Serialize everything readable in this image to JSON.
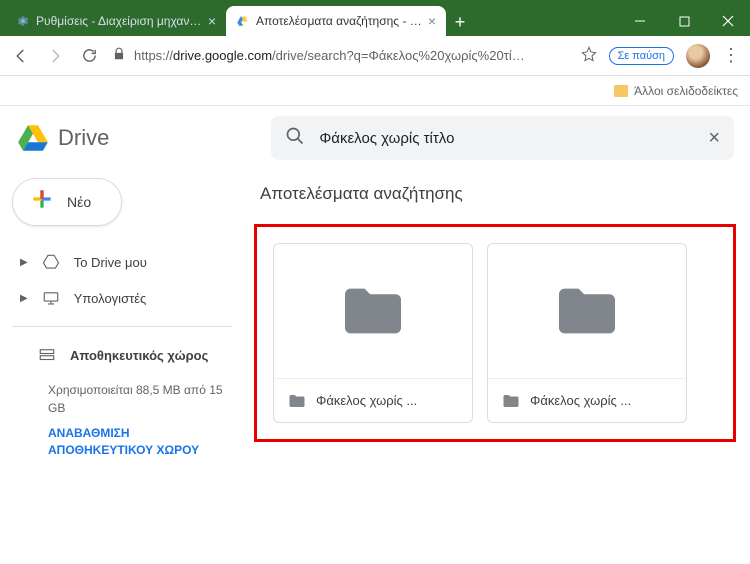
{
  "browser": {
    "tabs": [
      {
        "title": "Ρυθμίσεις - Διαχείριση μηχανών",
        "active": false
      },
      {
        "title": "Αποτελέσματα αναζήτησης - Go",
        "active": true
      }
    ],
    "url_prefix": "https://",
    "url_host": "drive.google.com",
    "url_path": "/drive/search?q=Φάκελος%20χωρίς%20τί…",
    "pause_label": "Σε παύση",
    "bookmarks_other": "Άλλοι σελιδοδείκτες"
  },
  "drive": {
    "brand": "Drive",
    "search_value": "Φάκελος χωρίς τίτλο",
    "new_label": "Νέο",
    "nav": {
      "mydrive": "Το Drive μου",
      "computers": "Υπολογιστές",
      "storage": "Αποθηκευτικός χώρος"
    },
    "storage_used": "Χρησιμοποιείται 88,5 MB από 15 GB",
    "upgrade": "ΑΝΑΒΑΘΜΙΣΗ ΑΠΟΘΗΚΕΥΤΙΚΟΥ ΧΩΡΟΥ",
    "results_title": "Αποτελέσματα αναζήτησης",
    "results": [
      {
        "name": "Φάκελος χωρίς ..."
      },
      {
        "name": "Φάκελος χωρίς ..."
      }
    ]
  }
}
